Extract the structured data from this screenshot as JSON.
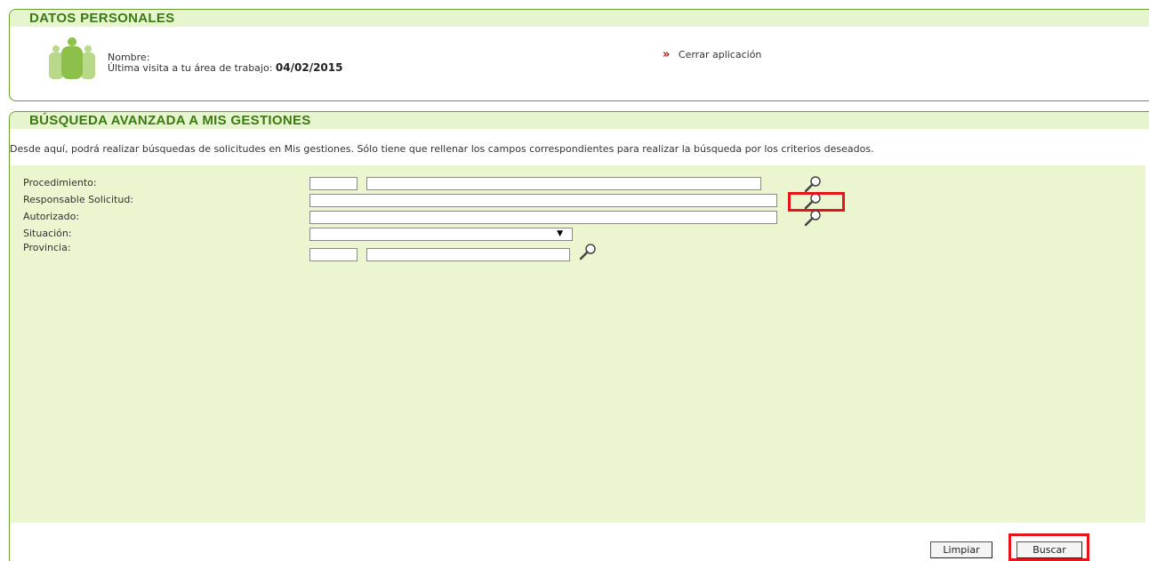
{
  "personal": {
    "title": "DATOS PERSONALES",
    "name_label": "Nombre:",
    "last_visit_label": "Última visita a tu área de trabajo:",
    "last_visit_date": "04/02/2015",
    "close_arrow": "»",
    "close_link": "Cerrar aplicación"
  },
  "search": {
    "title": "BÚSQUEDA AVANZADA A MIS GESTIONES",
    "description": "Desde aquí, podrá realizar búsquedas de solicitudes en Mis gestiones. Sólo tiene que rellenar los campos correspondientes para realizar la búsqueda por los criterios deseados.",
    "fields": {
      "procedimiento": "Procedimiento:",
      "responsable": "Responsable Solicitud:",
      "autorizado": "Autorizado:",
      "situacion": "Situación:",
      "provincia": "Provincia:"
    },
    "situacion_value": "",
    "buttons": {
      "clear": "Limpiar",
      "search": "Buscar"
    }
  },
  "colors": {
    "accent": "#3b7a12",
    "header_bg": "#e7f5cf",
    "form_bg": "#ebf5d0",
    "highlight": "#e8141c"
  },
  "icons": [
    "users-icon",
    "double-chevron-right-icon",
    "magnifier-icon"
  ]
}
